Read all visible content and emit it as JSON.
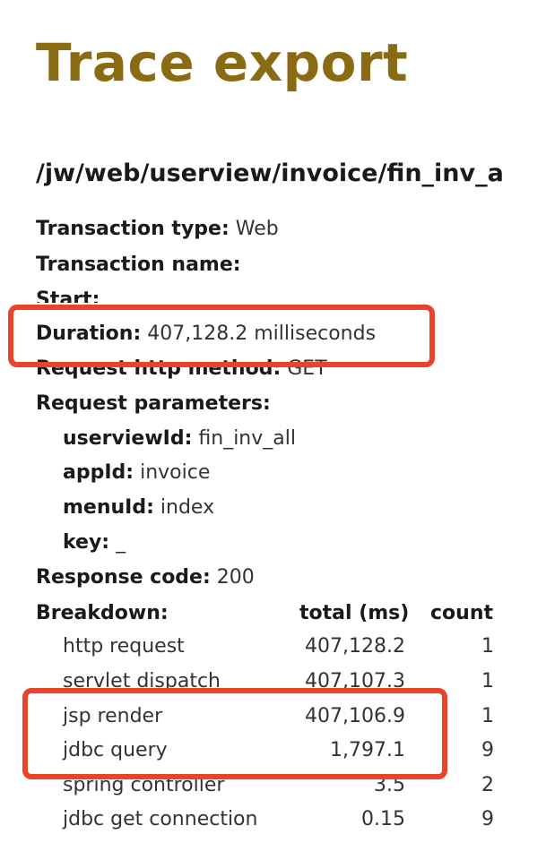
{
  "page": {
    "title": "Trace export",
    "trace_path": "/jw/web/userview/invoice/fin_inv_a"
  },
  "details": {
    "transaction_type": {
      "label": "Transaction type:",
      "value": "Web"
    },
    "transaction_name": {
      "label": "Transaction name:",
      "value": ""
    },
    "start": {
      "label": "Start:",
      "value": ""
    },
    "duration": {
      "label": "Duration:",
      "value": "407,128.2 milliseconds"
    },
    "request_http_method": {
      "label": "Request http method:",
      "value": "GET"
    },
    "request_parameters": {
      "label": "Request parameters:",
      "items": [
        {
          "label": "userviewId:",
          "value": "fin_inv_all"
        },
        {
          "label": "appId:",
          "value": "invoice"
        },
        {
          "label": "menuId:",
          "value": "index"
        },
        {
          "label": "key:",
          "value": "_"
        }
      ]
    },
    "response_code": {
      "label": "Response code:",
      "value": "200"
    }
  },
  "breakdown": {
    "label": "Breakdown:",
    "columns": [
      "total (ms)",
      "count"
    ],
    "rows": [
      {
        "name": "http request",
        "total": "407,128.2",
        "count": "1"
      },
      {
        "name": "servlet dispatch",
        "total": "407,107.3",
        "count": "1"
      },
      {
        "name": "jsp render",
        "total": "407,106.9",
        "count": "1"
      },
      {
        "name": "jdbc query",
        "total": "1,797.1",
        "count": "9"
      },
      {
        "name": "spring controller",
        "total": "3.5",
        "count": "2"
      },
      {
        "name": "jdbc get connection",
        "total": "0.15",
        "count": "9"
      }
    ]
  },
  "highlights": {
    "color": "#e8442a"
  },
  "colors": {
    "title": "#8b6a14",
    "text": "#222222"
  }
}
